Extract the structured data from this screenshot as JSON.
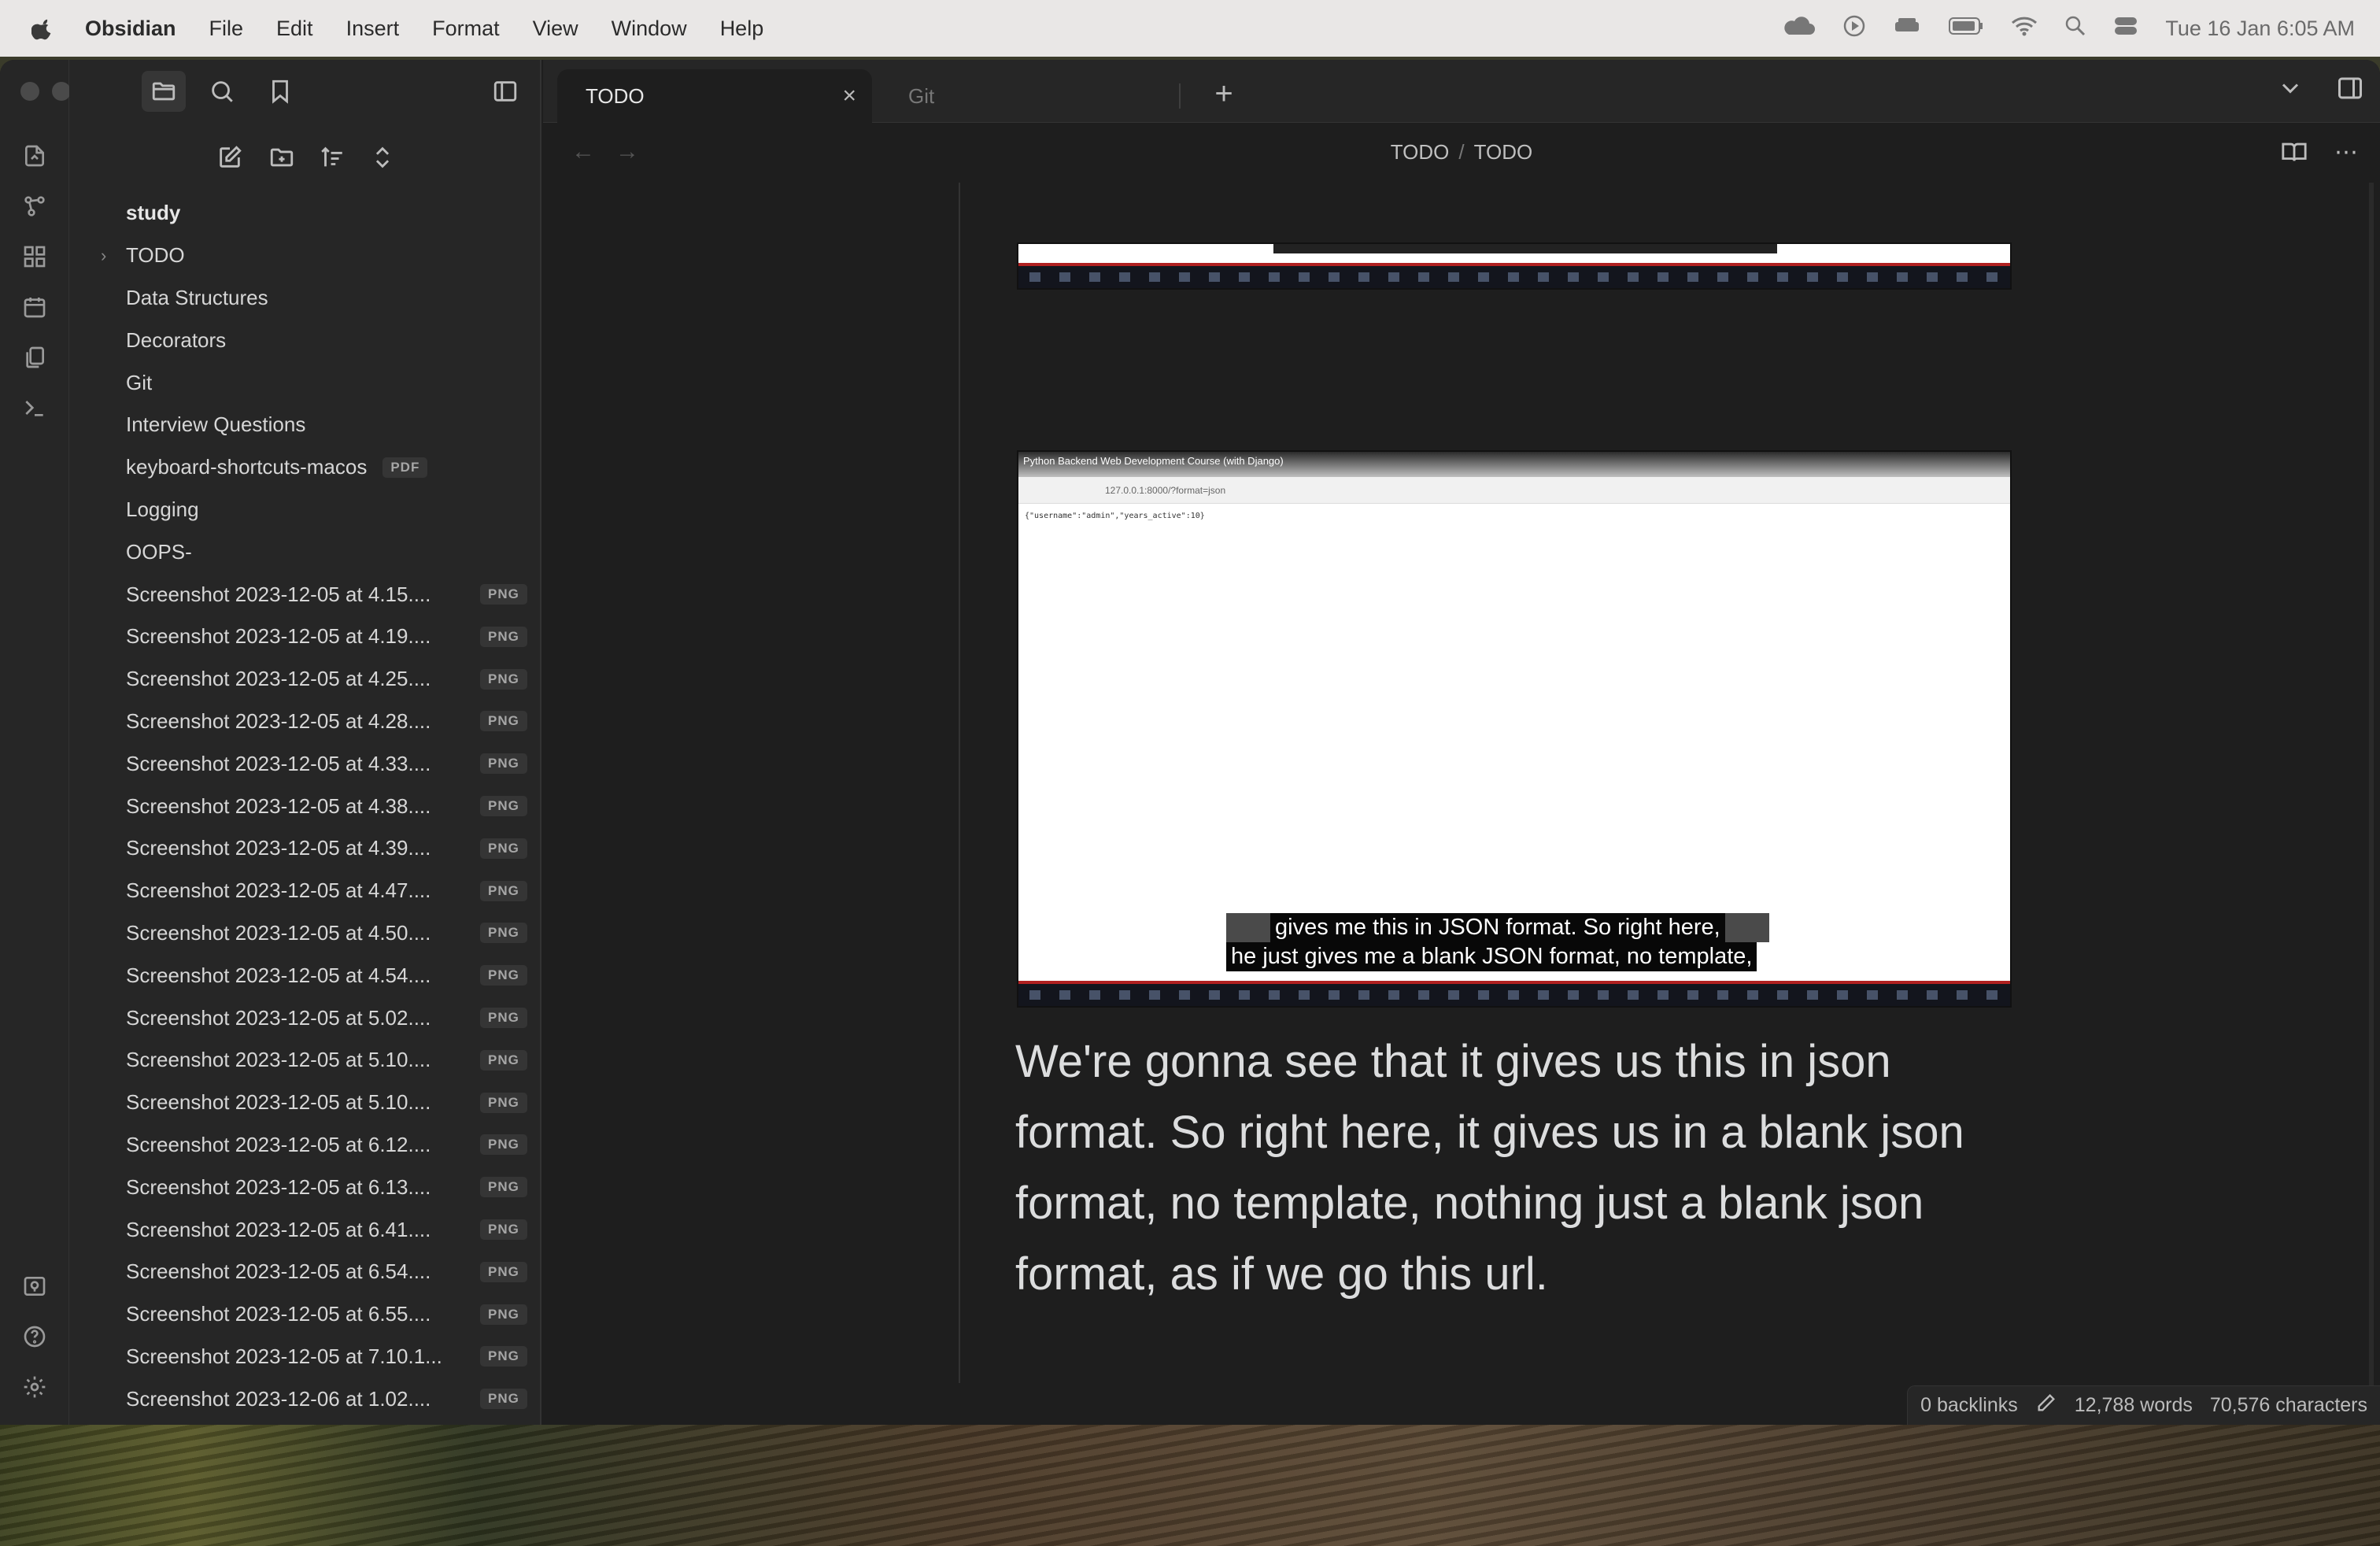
{
  "menubar": {
    "app_name": "Obsidian",
    "menus": [
      "File",
      "Edit",
      "Insert",
      "Format",
      "View",
      "Window",
      "Help"
    ],
    "clock": "Tue 16 Jan  6:05 AM"
  },
  "tabs": {
    "active": "TODO",
    "inactive": "Git",
    "new_tab": "+"
  },
  "breadcrumb": {
    "folder": "TODO",
    "separator": "/",
    "file": "TODO"
  },
  "sidebar": {
    "root": "study",
    "items": [
      {
        "label": "TODO",
        "type": "folder"
      },
      {
        "label": "Data Structures"
      },
      {
        "label": "Decorators"
      },
      {
        "label": "Git"
      },
      {
        "label": "Interview Questions"
      },
      {
        "label": "keyboard-shortcuts-macos",
        "badge": "PDF"
      },
      {
        "label": "Logging"
      },
      {
        "label": "OOPS-"
      },
      {
        "label": "Screenshot 2023-12-05 at 4.15....",
        "badge": "PNG"
      },
      {
        "label": "Screenshot 2023-12-05 at 4.19....",
        "badge": "PNG"
      },
      {
        "label": "Screenshot 2023-12-05 at 4.25....",
        "badge": "PNG"
      },
      {
        "label": "Screenshot 2023-12-05 at 4.28....",
        "badge": "PNG"
      },
      {
        "label": "Screenshot 2023-12-05 at 4.33....",
        "badge": "PNG"
      },
      {
        "label": "Screenshot 2023-12-05 at 4.38....",
        "badge": "PNG"
      },
      {
        "label": "Screenshot 2023-12-05 at 4.39....",
        "badge": "PNG"
      },
      {
        "label": "Screenshot 2023-12-05 at 4.47....",
        "badge": "PNG"
      },
      {
        "label": "Screenshot 2023-12-05 at 4.50....",
        "badge": "PNG"
      },
      {
        "label": "Screenshot 2023-12-05 at 4.54....",
        "badge": "PNG"
      },
      {
        "label": "Screenshot 2023-12-05 at 5.02....",
        "badge": "PNG"
      },
      {
        "label": "Screenshot 2023-12-05 at 5.10....",
        "badge": "PNG"
      },
      {
        "label": "Screenshot 2023-12-05 at 5.10....",
        "badge": "PNG"
      },
      {
        "label": "Screenshot 2023-12-05 at 6.12....",
        "badge": "PNG"
      },
      {
        "label": "Screenshot 2023-12-05 at 6.13....",
        "badge": "PNG"
      },
      {
        "label": "Screenshot 2023-12-05 at 6.41....",
        "badge": "PNG"
      },
      {
        "label": "Screenshot 2023-12-05 at 6.54....",
        "badge": "PNG"
      },
      {
        "label": "Screenshot 2023-12-05 at 6.55....",
        "badge": "PNG"
      },
      {
        "label": "Screenshot 2023-12-05 at 7.10.1...",
        "badge": "PNG"
      },
      {
        "label": "Screenshot 2023-12-06 at 1.02....",
        "badge": "PNG"
      }
    ]
  },
  "video": {
    "browser_title": "Python Backend Web Development Course (with Django)",
    "url": "127.0.0.1:8000/?format=json",
    "json_text": "{\"username\":\"admin\",\"years_active\":10}",
    "caption_line1": "gives me this in JSON format. So right here,",
    "caption_line2": "he just gives me a blank JSON format, no template,"
  },
  "note": {
    "paragraph": "We're gonna see that it gives us this in json format. So right here, it gives us in a blank json format, no template, nothing just a blank json format, as if we go this url."
  },
  "status": {
    "backlinks": "0 backlinks",
    "words": "12,788 words",
    "characters": "70,576 characters"
  }
}
